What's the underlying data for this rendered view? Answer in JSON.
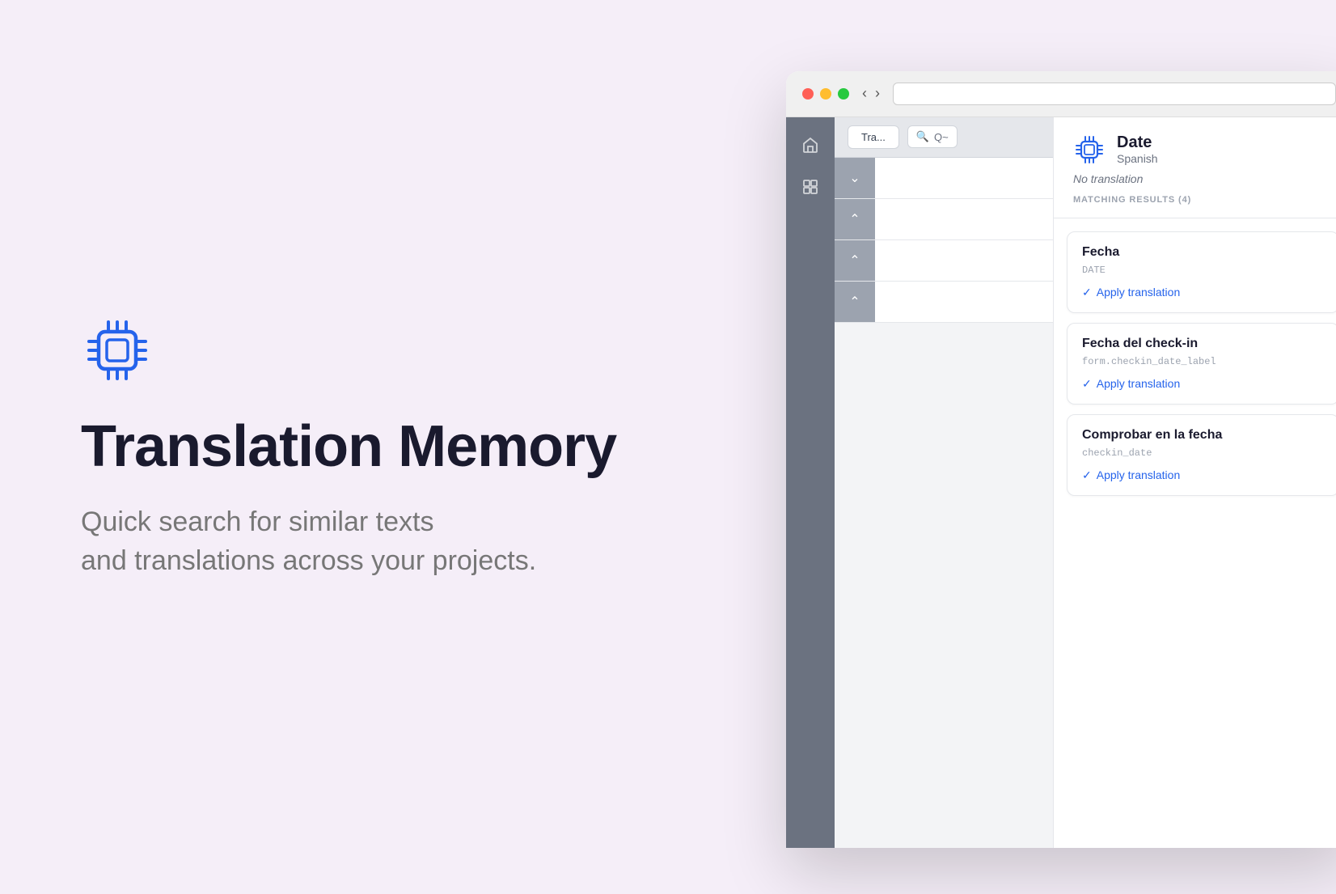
{
  "page": {
    "background": "#f5eef8"
  },
  "left": {
    "headline": "Translation Memory",
    "subheadline_line1": "Quick search for similar texts",
    "subheadline_line2": "and translations across your projects."
  },
  "browser": {
    "traffic_lights": [
      "red",
      "yellow",
      "green"
    ],
    "nav_back": "‹",
    "nav_forward": "›"
  },
  "panel": {
    "title": "Date",
    "subtitle": "Spanish",
    "no_translation_label": "No translation",
    "matching_label": "MATCHING RESULTS (4)",
    "results": [
      {
        "translation": "Fecha",
        "key": "DATE",
        "apply_label": "Apply translation"
      },
      {
        "translation": "Fecha del check-in",
        "key": "form.checkin_date_label",
        "apply_label": "Apply translation"
      },
      {
        "translation": "Comprobar en la fecha",
        "key": "checkin_date",
        "apply_label": "Apply translation"
      }
    ]
  },
  "sidebar": {
    "icons": [
      "home",
      "grid"
    ]
  },
  "toolbar": {
    "tab_label": "Tra...",
    "search_placeholder": "Q~"
  }
}
